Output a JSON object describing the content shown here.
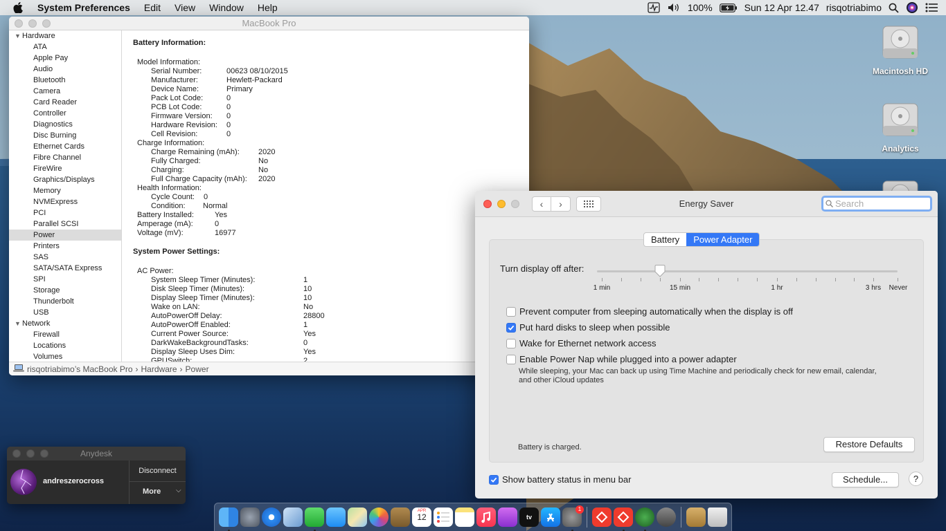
{
  "menubar": {
    "app_name": "System Preferences",
    "menus": [
      "Edit",
      "View",
      "Window",
      "Help"
    ],
    "battery_pct": "100%",
    "datetime": "Sun 12 Apr  12.47",
    "username": "risqotriabimo"
  },
  "desktop": {
    "icons": [
      "Macintosh HD",
      "Analytics"
    ]
  },
  "sysinfo": {
    "title": "MacBook Pro",
    "sidebar": {
      "hardware_group": "Hardware",
      "hardware_items": [
        "ATA",
        "Apple Pay",
        "Audio",
        "Bluetooth",
        "Camera",
        "Card Reader",
        "Controller",
        "Diagnostics",
        "Disc Burning",
        "Ethernet Cards",
        "Fibre Channel",
        "FireWire",
        "Graphics/Displays",
        "Memory",
        "NVMExpress",
        "PCI",
        "Parallel SCSI",
        "Power",
        "Printers",
        "SAS",
        "SATA/SATA Express",
        "SPI",
        "Storage",
        "Thunderbolt",
        "USB"
      ],
      "selected": "Power",
      "network_group": "Network",
      "network_items": [
        "Firewall",
        "Locations",
        "Volumes"
      ]
    },
    "battery_title": "Battery Information:",
    "model_info": {
      "heading": "Model Information:",
      "rows": [
        [
          "Serial Number:",
          "00623 08/10/2015"
        ],
        [
          "Manufacturer:",
          "Hewlett-Packard"
        ],
        [
          "Device Name:",
          "Primary"
        ],
        [
          "Pack Lot Code:",
          "0"
        ],
        [
          "PCB Lot Code:",
          "0"
        ],
        [
          "Firmware Version:",
          "0"
        ],
        [
          "Hardware Revision:",
          "0"
        ],
        [
          "Cell Revision:",
          "0"
        ]
      ]
    },
    "charge_info": {
      "heading": "Charge Information:",
      "rows": [
        [
          "Charge Remaining (mAh):",
          "2020"
        ],
        [
          "Fully Charged:",
          "No"
        ],
        [
          "Charging:",
          "No"
        ],
        [
          "Full Charge Capacity (mAh):",
          "2020"
        ]
      ]
    },
    "health_info": {
      "heading": "Health Information:",
      "rows": [
        [
          "Cycle Count:",
          "0"
        ],
        [
          "Condition:",
          "Normal"
        ]
      ]
    },
    "top_rows": [
      [
        "Battery Installed:",
        "Yes"
      ],
      [
        "Amperage (mA):",
        "0"
      ],
      [
        "Voltage (mV):",
        "16977"
      ]
    ],
    "power_title": "System Power Settings:",
    "ac_power": {
      "heading": "AC Power:",
      "rows": [
        [
          "System Sleep Timer (Minutes):",
          "1"
        ],
        [
          "Disk Sleep Timer (Minutes):",
          "10"
        ],
        [
          "Display Sleep Timer (Minutes):",
          "10"
        ],
        [
          "Wake on LAN:",
          "No"
        ],
        [
          "AutoPowerOff Delay:",
          "28800"
        ],
        [
          "AutoPowerOff Enabled:",
          "1"
        ],
        [
          "Current Power Source:",
          "Yes"
        ],
        [
          "DarkWakeBackgroundTasks:",
          "0"
        ],
        [
          "Display Sleep Uses Dim:",
          "Yes"
        ],
        [
          "GPUSwitch:",
          "2"
        ]
      ]
    },
    "pathbar": [
      "risqotriabimo’s MacBook Pro",
      "Hardware",
      "Power"
    ]
  },
  "energy": {
    "title": "Energy Saver",
    "search_placeholder": "Search",
    "tabs": [
      "Battery",
      "Power Adapter"
    ],
    "active_tab": "Power Adapter",
    "slider_label": "Turn display off after:",
    "slider_ticks": [
      "1 min",
      "15 min",
      "1 hr",
      "3 hrs",
      "Never"
    ],
    "slider_value": "10 min",
    "checkboxes": [
      {
        "label": "Prevent computer from sleeping automatically when the display is off",
        "checked": false
      },
      {
        "label": "Put hard disks to sleep when possible",
        "checked": true
      },
      {
        "label": "Wake for Ethernet network access",
        "checked": false
      },
      {
        "label": "Enable Power Nap while plugged into a power adapter",
        "checked": false
      }
    ],
    "power_nap_desc": "While sleeping, your Mac can back up using Time Machine and periodically check for new email, calendar, and other iCloud updates",
    "status": "Battery is charged.",
    "restore_label": "Restore Defaults",
    "show_battery_label": "Show battery status in menu bar",
    "show_battery_checked": true,
    "schedule_label": "Schedule...",
    "help_label": "?",
    "accent": "#3478f6"
  },
  "anydesk": {
    "title": "Anydesk",
    "user": "andreszerocross",
    "disconnect_label": "Disconnect",
    "more_label": "More"
  },
  "dock": {
    "calendar_month": "APR",
    "calendar_day": "12",
    "badge_count": "1",
    "apps": [
      "finder",
      "launchpad",
      "safari",
      "preview",
      "facetime",
      "messages",
      "maps",
      "photos",
      "notefile",
      "calendar",
      "reminders",
      "notes",
      "music",
      "podcasts",
      "tv",
      "app-store",
      "system-preferences",
      "anydesk",
      "anydesk-2",
      "globe",
      "automator",
      "archive-utility",
      "trash"
    ]
  }
}
